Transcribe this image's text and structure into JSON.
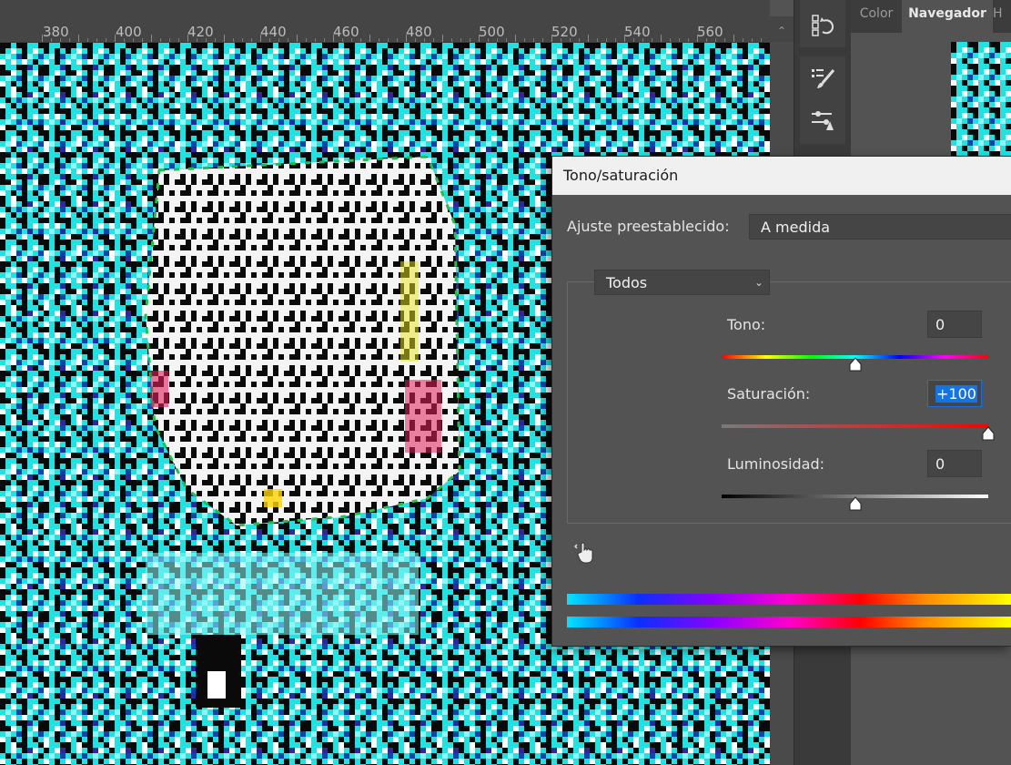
{
  "ruler": {
    "labels": [
      "380",
      "400",
      "420",
      "440",
      "460",
      "480",
      "500",
      "520",
      "540",
      "560"
    ],
    "scroll_up_arrow": "⌃"
  },
  "panel": {
    "tabs": {
      "color": "Color",
      "navigator": "Navegador",
      "more": "H"
    }
  },
  "toolstrip": {
    "icons": [
      "history-icon",
      "brush-presets-icon",
      "adjustments-icon"
    ]
  },
  "dialog": {
    "title": "Tono/saturación",
    "preset_label": "Ajuste preestablecido:",
    "preset_value": "A medida",
    "channel_value": "Todos",
    "hue": {
      "label": "Tono:",
      "value": "0",
      "position": 0.5
    },
    "saturation": {
      "label": "Saturación:",
      "value": "+100",
      "position": 1.0
    },
    "lightness": {
      "label": "Luminosidad:",
      "value": "0",
      "position": 0.5
    }
  },
  "colors": {
    "canvas_cyan": "#1fe3e3",
    "panel_bg": "#535353",
    "focus_blue": "#1473e6"
  }
}
